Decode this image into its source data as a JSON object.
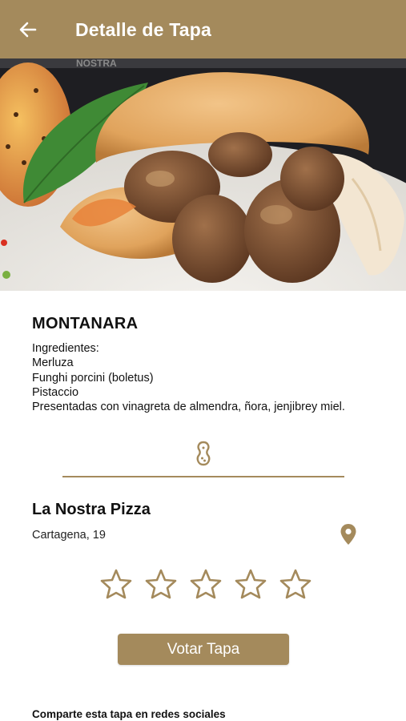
{
  "appbar": {
    "title": "Detalle de Tapa",
    "back_icon": "arrow-left-icon",
    "background": "#a48a5c"
  },
  "hero": {
    "description_icon": "tapa-photo"
  },
  "tapa": {
    "name": "MONTANARA",
    "ingredients_heading": "Ingredientes:",
    "ingredients": [
      "Merluza",
      "Funghi porcini (boletus)",
      "Pistaccio",
      "Presentadas con vinagreta de almendra, ñora, jenjibrey miel."
    ]
  },
  "divider": {
    "icon": "peanut-icon"
  },
  "restaurant": {
    "name": "La Nostra Pizza",
    "address": "Cartagena, 19",
    "location_icon": "map-pin-icon"
  },
  "rating": {
    "max_stars": 5,
    "value": 0
  },
  "vote": {
    "label": "Votar Tapa"
  },
  "share": {
    "label": "Comparte esta tapa en redes sociales"
  },
  "colors": {
    "accent": "#a48a5c",
    "text": "#111111",
    "background": "#ffffff"
  }
}
